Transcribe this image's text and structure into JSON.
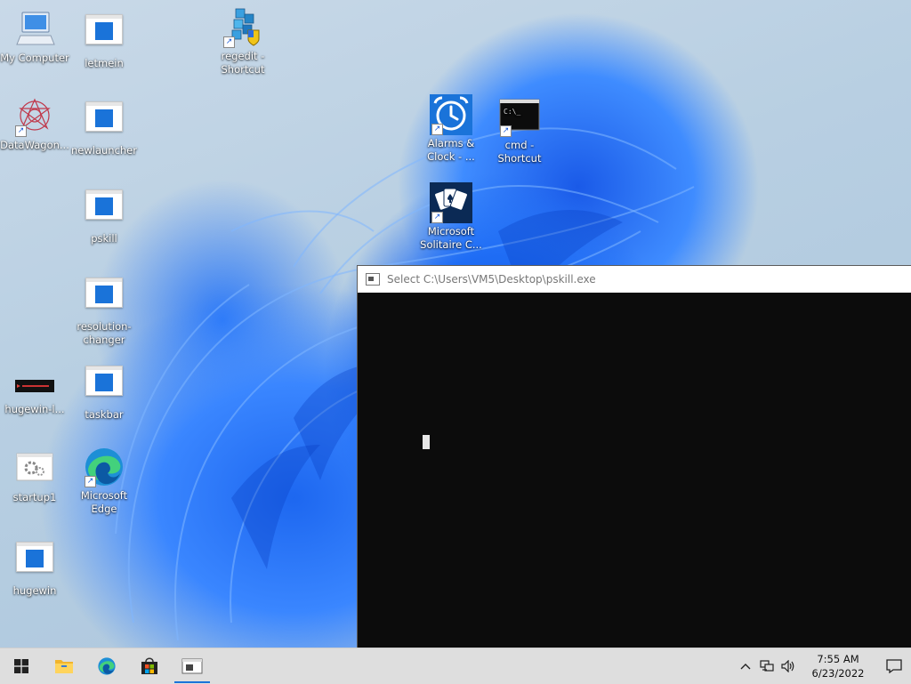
{
  "desktop": {
    "icons": [
      {
        "label": "My Computer"
      },
      {
        "label": "letmein"
      },
      {
        "label": "regedit - Shortcut"
      },
      {
        "label": "DataWagon..."
      },
      {
        "label": "newlauncher"
      },
      {
        "label": "pskill"
      },
      {
        "label": "resolution-changer"
      },
      {
        "label": "hugewin-l..."
      },
      {
        "label": "taskbar"
      },
      {
        "label": "startup1"
      },
      {
        "label": "Microsoft Edge"
      },
      {
        "label": "hugewin"
      },
      {
        "label": "Alarms & Clock - ..."
      },
      {
        "label": "cmd - Shortcut"
      },
      {
        "label": "Microsoft Solitaire C..."
      }
    ]
  },
  "console": {
    "title": "Select C:\\Users\\VM5\\Desktop\\pskill.exe"
  },
  "taskbar": {
    "buttons": [
      "start-icon",
      "file-explorer-icon",
      "edge-icon",
      "store-icon",
      "console-app-icon"
    ],
    "clock_time": "7:55 AM",
    "clock_date": "6/23/2022"
  }
}
